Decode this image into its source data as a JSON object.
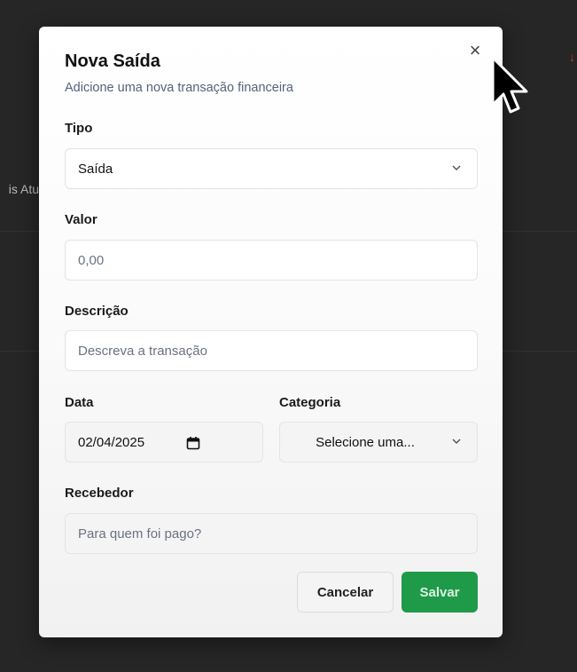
{
  "background": {
    "partial_text": "is Atu",
    "arrow_glyph": "↓"
  },
  "modal": {
    "title": "Nova Saída",
    "subtitle": "Adicione uma nova transação financeira",
    "close_glyph": "×"
  },
  "form": {
    "tipo": {
      "label": "Tipo",
      "value": "Saída"
    },
    "valor": {
      "label": "Valor",
      "placeholder": "0,00"
    },
    "descricao": {
      "label": "Descrição",
      "placeholder": "Descreva a transação"
    },
    "data": {
      "label": "Data",
      "value": "02/04/2025"
    },
    "categoria": {
      "label": "Categoria",
      "placeholder": "Selecione uma..."
    },
    "recebedor": {
      "label": "Recebedor",
      "placeholder": "Para quem foi pago?"
    }
  },
  "actions": {
    "cancel_label": "Cancelar",
    "save_label": "Salvar"
  },
  "colors": {
    "save_button": "#1f9a49",
    "overlay": "#262626"
  },
  "icons": [
    "close-icon",
    "chevron-down-icon",
    "calendar-icon",
    "mouse-cursor-icon"
  ]
}
